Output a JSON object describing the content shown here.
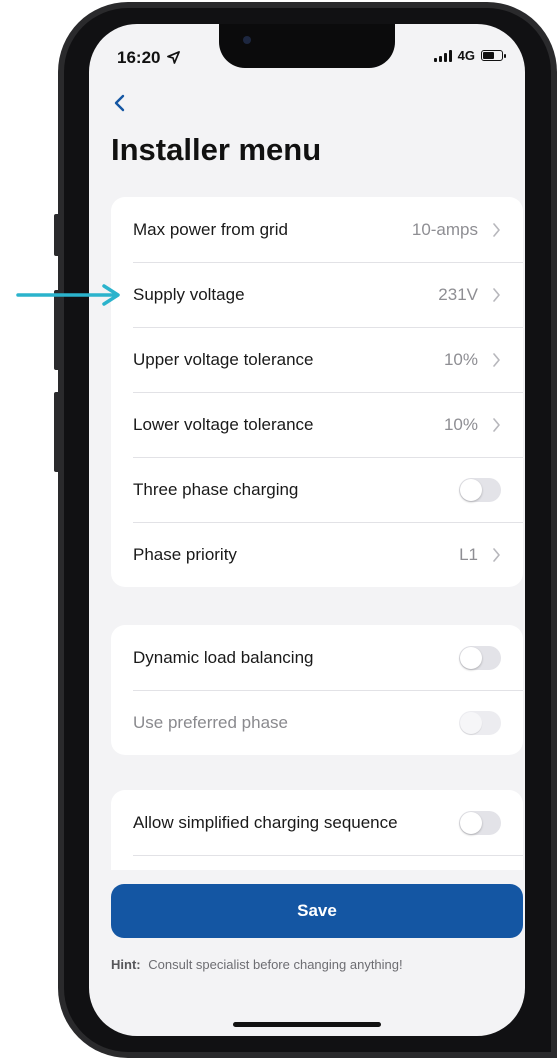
{
  "status_bar": {
    "time": "16:20",
    "network": "4G"
  },
  "header": {
    "title": "Installer menu"
  },
  "group1": {
    "rows": [
      {
        "label": "Max power from grid",
        "value": "10-amps"
      },
      {
        "label": "Supply voltage",
        "value": "231V"
      },
      {
        "label": "Upper voltage tolerance",
        "value": "10%"
      },
      {
        "label": "Lower voltage tolerance",
        "value": "10%"
      },
      {
        "label": "Three phase charging",
        "toggle": false
      },
      {
        "label": "Phase priority",
        "value": "L1"
      }
    ]
  },
  "group2": {
    "rows": [
      {
        "label": "Dynamic load balancing",
        "toggle": false
      },
      {
        "label": "Use preferred phase",
        "toggle": false,
        "disabled": true
      }
    ]
  },
  "group3": {
    "rows": [
      {
        "label": "Allow simplified charging sequence",
        "toggle": false
      }
    ]
  },
  "save": {
    "label": "Save"
  },
  "hint": {
    "prefix": "Hint:",
    "text": "Consult specialist before changing anything!"
  },
  "colors": {
    "primary": "#1456a3",
    "arrow": "#2bb3cc",
    "background": "#f3f3f5"
  }
}
